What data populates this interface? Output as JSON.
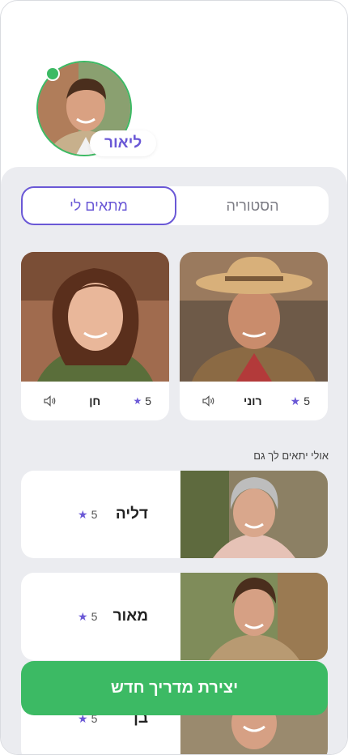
{
  "profile": {
    "name": "ליאור",
    "online": true
  },
  "tabs": [
    {
      "label": "הסטוריה",
      "active": false
    },
    {
      "label": "מתאים לי",
      "active": true
    }
  ],
  "featured": [
    {
      "name": "רוני",
      "rating": "5"
    },
    {
      "name": "חן",
      "rating": "5"
    }
  ],
  "section_title": "אולי יתאים לך גם",
  "suggestions": [
    {
      "name": "דליה",
      "rating": "5"
    },
    {
      "name": "מאור",
      "rating": "5"
    },
    {
      "name": "בן",
      "rating": "5"
    }
  ],
  "cta_label": "יצירת מדריך חדש",
  "colors": {
    "accent": "#6a58d6",
    "green": "#3cba64",
    "panel": "#ebecf0"
  },
  "icons": [
    "star-icon",
    "speaker-icon"
  ]
}
